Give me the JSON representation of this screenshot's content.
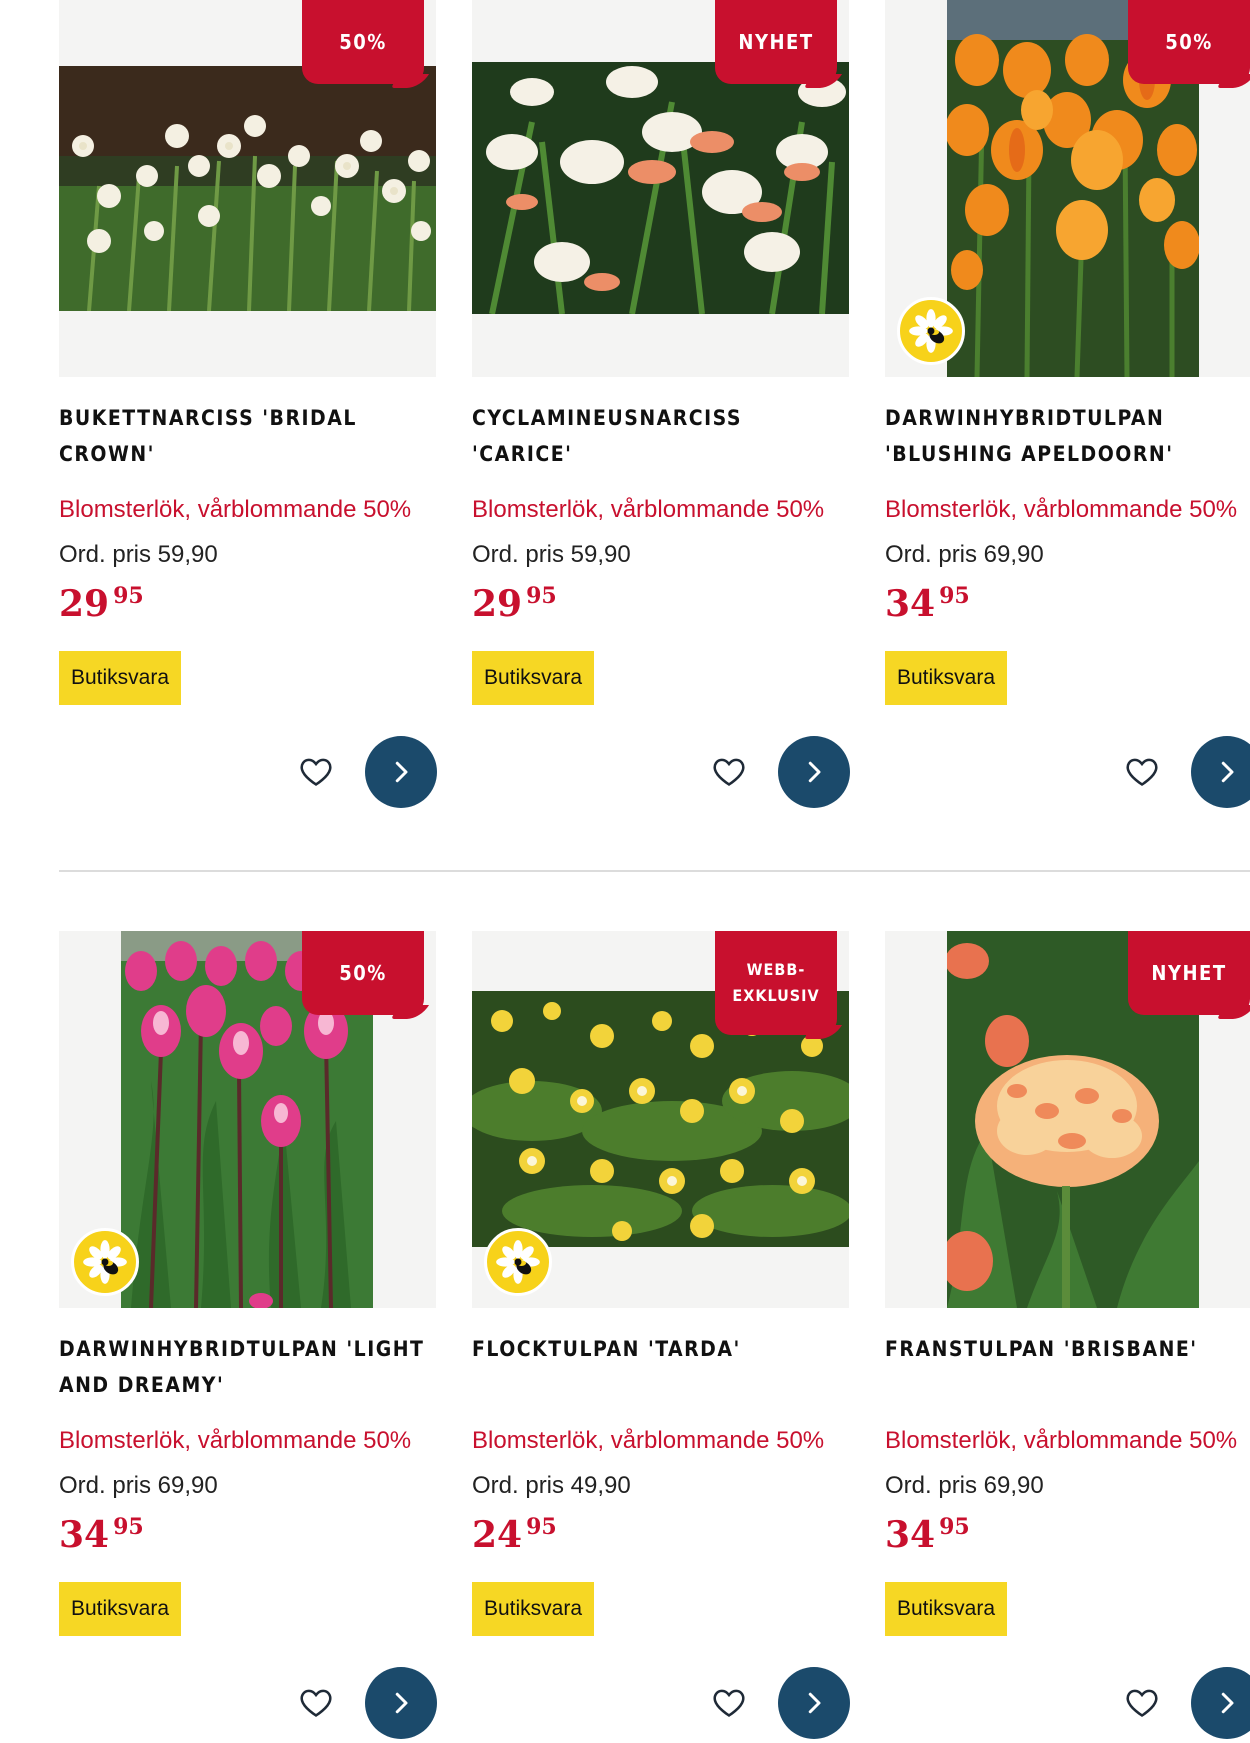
{
  "products": [
    {
      "badge": "50%",
      "name": "Bukettnarciss 'Bridal Crown'",
      "category": "Blomsterlök, vårblommande 50%",
      "ord_price": "Ord. pris 59,90",
      "price_main": "29",
      "price_dec": "95",
      "stock": "Butiksvara",
      "photo": "white-narcissus"
    },
    {
      "badge": "NYHET",
      "name": "Cyclamineusnarciss 'Carice'",
      "category": "Blomsterlök, vårblommande 50%",
      "ord_price": "Ord. pris 59,90",
      "price_main": "29",
      "price_dec": "95",
      "stock": "Butiksvara",
      "photo": "white-pink-narcissus"
    },
    {
      "badge": "50%",
      "name": "Darwinhybridtulpan 'Blushing Apeldoorn'",
      "category": "Blomsterlök, vårblommande 50%",
      "ord_price": "Ord. pris 69,90",
      "price_main": "34",
      "price_dec": "95",
      "stock": "Butiksvara",
      "photo": "orange-tulips",
      "pollinator": true
    },
    {
      "badge": "50%",
      "name": "Darwinhybridtulpan 'Light and Dreamy'",
      "category": "Blomsterlök, vårblommande 50%",
      "ord_price": "Ord. pris 69,90",
      "price_main": "34",
      "price_dec": "95",
      "stock": "Butiksvara",
      "photo": "pink-tulips",
      "pollinator": true
    },
    {
      "badge_line1": "WEBB-",
      "badge_line2": "EXKLUSIV",
      "name": "Flocktulpan 'Tarda'",
      "category": "Blomsterlök, vårblommande 50%",
      "ord_price": "Ord. pris 49,90",
      "price_main": "24",
      "price_dec": "95",
      "stock": "Butiksvara",
      "photo": "yellow-star-tulips",
      "pollinator": true
    },
    {
      "badge": "NYHET",
      "name": "Franstulpan 'Brisbane'",
      "category": "Blomsterlök, vårblommande 50%",
      "ord_price": "Ord. pris 69,90",
      "price_main": "34",
      "price_dec": "95",
      "stock": "Butiksvara",
      "photo": "fringed-peach-tulip"
    }
  ],
  "icons": {
    "favorite": "heart-icon",
    "open": "chevron-right-icon",
    "pollinator": "bee-flower-icon"
  },
  "colors": {
    "sale_red": "#c8102e",
    "stock_yellow": "#f6d724",
    "button_blue": "#1b4a6b",
    "image_bg": "#f4f4f3"
  }
}
